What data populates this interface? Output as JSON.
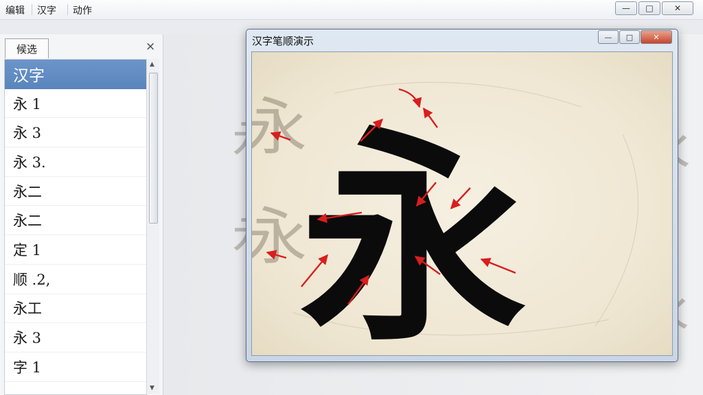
{
  "menubar": {
    "items": [
      "编辑",
      "汉字",
      "动作"
    ]
  },
  "window": {
    "minimize_label": "—",
    "maximize_label": "□",
    "close_label": "✕"
  },
  "left_panel": {
    "tab_label": "候选",
    "close_label": "×",
    "items": [
      "汉字",
      "永 1",
      "永 3",
      "永 3.",
      "永二",
      "永二",
      "定 1",
      "顺 .2,",
      "永工",
      "永 3",
      "字 1"
    ]
  },
  "dialog": {
    "title": "汉字笔顺演示",
    "minimize_label": "—",
    "maximize_label": "□",
    "close_label": "✕"
  },
  "canvas": {
    "main_character": "永",
    "ghost_character": "永",
    "arrow_color": "#d81e1e"
  }
}
